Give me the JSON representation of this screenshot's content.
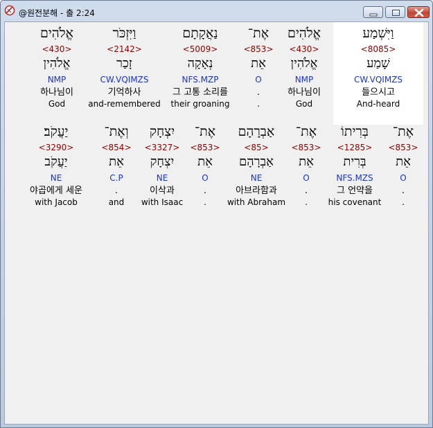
{
  "window": {
    "title": "@원전분해 - 출 2:24"
  },
  "rows": [
    {
      "words": [
        {
          "heb": "וַיִּשְׁמַע",
          "strong": "<8085>",
          "lemma": "שָׁמַע",
          "morph": "CW.VQIMZS",
          "korean": "들으시고",
          "gloss": "And-heard",
          "highlight": true
        },
        {
          "heb": "אֱלֹהִים",
          "strong": "<430>",
          "lemma": "אֱלֹהִין",
          "morph": "NMP",
          "korean": "하나님이",
          "gloss": "God",
          "highlight": false
        },
        {
          "heb": "אֶת־",
          "strong": "<853>",
          "lemma": "אֵת",
          "morph": "O",
          "korean": ".",
          "gloss": ".",
          "highlight": false
        },
        {
          "heb": "נַאֲקָתָם",
          "strong": "<5009>",
          "lemma": "נְאָקָה",
          "morph": "NFS.MZP",
          "korean": "그 고통 소리를",
          "gloss": "their groaning",
          "highlight": false
        },
        {
          "heb": "וַיִּזְכֹּר",
          "strong": "<2142>",
          "lemma": "זָכַר",
          "morph": "CW.VQIMZS",
          "korean": "기억하사",
          "gloss": "and-remembered",
          "highlight": false
        },
        {
          "heb": "אֱלֹהִים",
          "strong": "<430>",
          "lemma": "אֱלֹהִין",
          "morph": "NMP",
          "korean": "하나님이",
          "gloss": "God",
          "highlight": false
        }
      ]
    },
    {
      "words": [
        {
          "heb": "אֶת־",
          "strong": "<853>",
          "lemma": "אֵת",
          "morph": "O",
          "korean": ".",
          "gloss": ".",
          "highlight": false
        },
        {
          "heb": "בְּרִיתוֹ",
          "strong": "<1285>",
          "lemma": "בְּרִית",
          "morph": "NFS.MZS",
          "korean": "그 언약을",
          "gloss": "his covenant",
          "highlight": false
        },
        {
          "heb": "אֶת־",
          "strong": "<853>",
          "lemma": "אֵת",
          "morph": "O",
          "korean": ".",
          "gloss": ".",
          "highlight": false
        },
        {
          "heb": "אַבְרָהָם",
          "strong": "<85>",
          "lemma": "אַבְרָהָם",
          "morph": "NE",
          "korean": "아브라함과",
          "gloss": "with Abraham",
          "highlight": false
        },
        {
          "heb": "אֶת־",
          "strong": "<853>",
          "lemma": "אֵת",
          "morph": "O",
          "korean": ".",
          "gloss": ".",
          "highlight": false
        },
        {
          "heb": "יִצְחָק",
          "strong": "<3327>",
          "lemma": "יִצְחָק",
          "morph": "NE",
          "korean": "이삭과",
          "gloss": "with Isaac",
          "highlight": false
        },
        {
          "heb": "וְאֶת־",
          "strong": "<854>",
          "lemma": "אֵת",
          "morph": "C.P",
          "korean": ".",
          "gloss": "and",
          "highlight": false
        },
        {
          "heb": "יַעֲקֹב׃",
          "strong": "<3290>",
          "lemma": "יַעֲקֹב",
          "morph": "NE",
          "korean": "야곱에게 세운",
          "gloss": "with Jacob",
          "highlight": false
        }
      ]
    }
  ],
  "colors": {
    "strong": "#8b0000",
    "morph": "#1c33c8",
    "highlight_bg": "#ffffff",
    "client_bg": "#f0f0f0"
  }
}
